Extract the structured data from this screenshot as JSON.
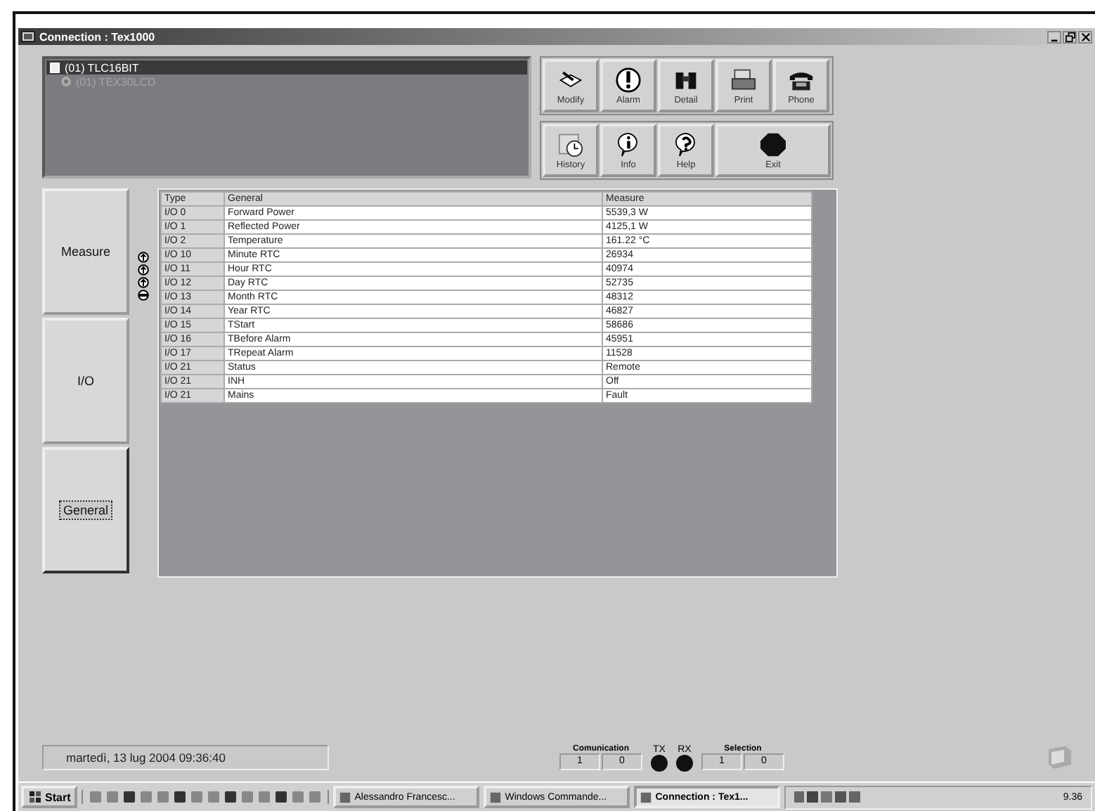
{
  "window": {
    "title": "Connection : Tex1000"
  },
  "device_tree": [
    {
      "label": "(01) TLC16BIT",
      "selected": true
    },
    {
      "label": "(01) TEX30LCD",
      "selected": false
    }
  ],
  "toolbar": [
    [
      {
        "label": "Modify",
        "kind": "modify"
      },
      {
        "label": "Alarm",
        "kind": "alarm"
      },
      {
        "label": "Detail",
        "kind": "detail"
      },
      {
        "label": "Print",
        "kind": "print"
      },
      {
        "label": "Phone",
        "kind": "phone"
      }
    ],
    [
      {
        "label": "History",
        "kind": "history"
      },
      {
        "label": "Info",
        "kind": "info"
      },
      {
        "label": "Help",
        "kind": "help"
      },
      {
        "label": "Exit",
        "kind": "exit"
      }
    ]
  ],
  "tabs": [
    {
      "label": "Measure",
      "selected": false
    },
    {
      "label": "I/O",
      "selected": false
    },
    {
      "label": "General",
      "selected": true
    }
  ],
  "table": {
    "columns": [
      "Type",
      "General",
      "Measure"
    ],
    "rows": [
      [
        "I/O 0",
        "Forward Power",
        "5539,3 W"
      ],
      [
        "I/O 1",
        "Reflected Power",
        "4125,1 W"
      ],
      [
        "I/O 2",
        "Temperature",
        "161.22 °C"
      ],
      [
        "I/O 10",
        "Minute RTC",
        "26934"
      ],
      [
        "I/O 11",
        "Hour RTC",
        "40974"
      ],
      [
        "I/O 12",
        "Day RTC",
        "52735"
      ],
      [
        "I/O 13",
        "Month RTC",
        "48312"
      ],
      [
        "I/O 14",
        "Year RTC",
        "46827"
      ],
      [
        "I/O 15",
        "TStart",
        "58686"
      ],
      [
        "I/O 16",
        "TBefore Alarm",
        "45951"
      ],
      [
        "I/O 17",
        "TRepeat Alarm",
        "11528"
      ],
      [
        "I/O 21",
        "Status",
        "Remote"
      ],
      [
        "I/O 21",
        "INH",
        "Off"
      ],
      [
        "I/O 21",
        "Mains",
        "Fault"
      ]
    ]
  },
  "status_bar": {
    "datetime": "martedì, 13 lug 2004  09:36:40",
    "communication": {
      "label": "Comunication",
      "values": [
        "1",
        "0"
      ]
    },
    "tx": "TX",
    "rx": "RX",
    "selection": {
      "label": "Selection",
      "values": [
        "1",
        "0"
      ]
    }
  },
  "taskbar": {
    "start": "Start",
    "tasks": [
      {
        "label": "Alessandro Francesc...",
        "selected": false
      },
      {
        "label": "Windows Commande...",
        "selected": false
      },
      {
        "label": "Connection : Tex1...",
        "selected": true
      }
    ],
    "clock": "9.36"
  }
}
